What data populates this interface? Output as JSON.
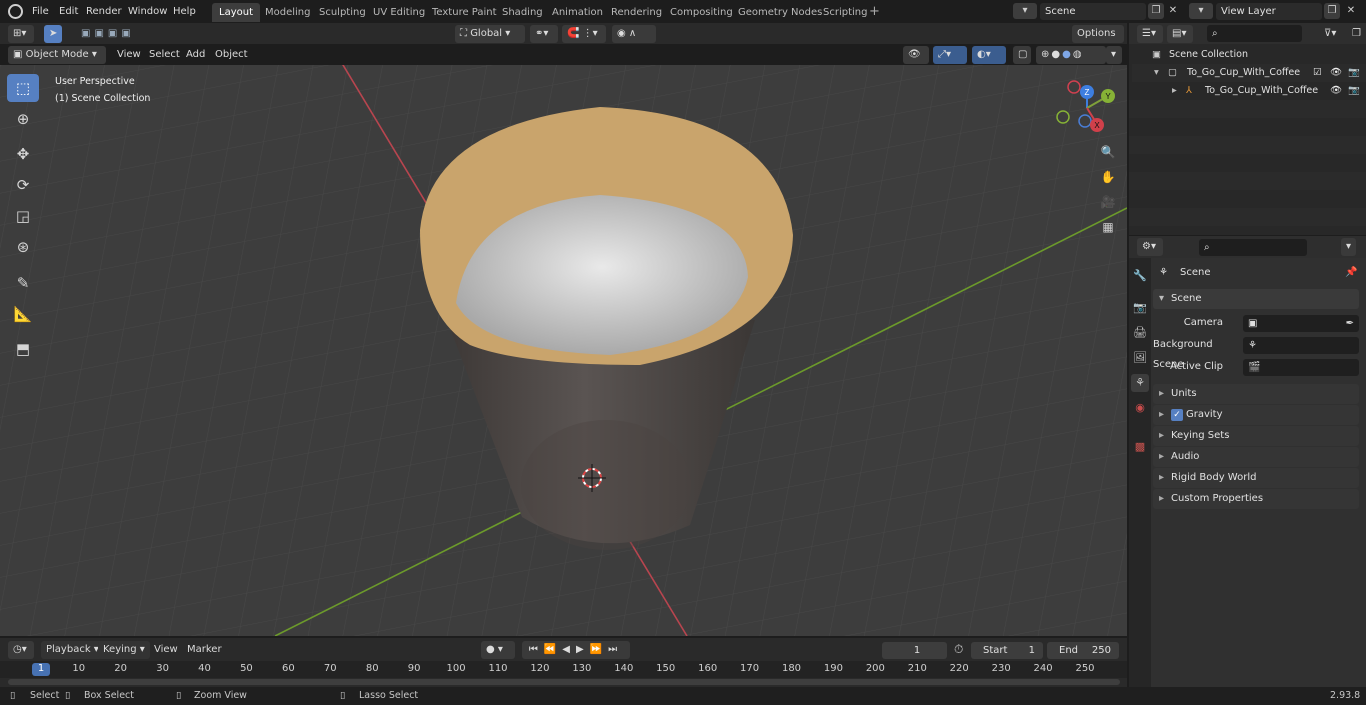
{
  "app": {
    "version": "2.93.8"
  },
  "menus": [
    "File",
    "Edit",
    "Render",
    "Window",
    "Help"
  ],
  "workspaces": [
    "Layout",
    "Modeling",
    "Sculpting",
    "UV Editing",
    "Texture Paint",
    "Shading",
    "Animation",
    "Rendering",
    "Compositing",
    "Geometry Nodes",
    "Scripting"
  ],
  "active_workspace": "Layout",
  "scene_field": "Scene",
  "view_layer_field": "View Layer",
  "viewport": {
    "mode": "Object Mode",
    "menus": [
      "View",
      "Select",
      "Add",
      "Object"
    ],
    "transform_orientation": "Global",
    "options_label": "Options",
    "overlay_line1": "User Perspective",
    "overlay_line2": "(1) Scene Collection",
    "gizmo_axes": {
      "x": "X",
      "y": "Y",
      "z": "Z"
    }
  },
  "outliner": {
    "root": "Scene Collection",
    "collection": "To_Go_Cup_With_Coffee",
    "object": "To_Go_Cup_With_Coffee"
  },
  "properties": {
    "context": "Scene",
    "panel_title": "Scene",
    "camera_label": "Camera",
    "background_scene_label": "Background Scene",
    "active_clip_label": "Active Clip",
    "subpanels": [
      "Units",
      "Gravity",
      "Keying Sets",
      "Audio",
      "Rigid Body World",
      "Custom Properties"
    ]
  },
  "timeline": {
    "menus": [
      "Playback",
      "Keying",
      "View",
      "Marker"
    ],
    "current_frame": "1",
    "start_label": "Start",
    "start_value": "1",
    "end_label": "End",
    "end_value": "250",
    "ticks": [
      "1",
      "10",
      "20",
      "30",
      "40",
      "50",
      "60",
      "70",
      "80",
      "90",
      "100",
      "110",
      "120",
      "130",
      "140",
      "150",
      "160",
      "170",
      "180",
      "190",
      "200",
      "210",
      "220",
      "230",
      "240",
      "250"
    ]
  },
  "statusbar": {
    "select": "Select",
    "box_select": "Box Select",
    "zoom_view": "Zoom View",
    "lasso_select": "Lasso Select"
  },
  "colors": {
    "accent": "#5680c2",
    "x_axis": "#b8454f",
    "y_axis": "#6c9a2b",
    "cup_rim": "#c9a46c",
    "coffee_foam": "#d8d8d8",
    "cup_body": "#4a4442"
  }
}
